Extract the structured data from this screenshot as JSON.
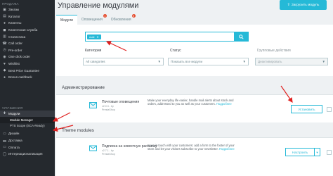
{
  "sidebar": {
    "section_sell": "ПРОДАЖА",
    "items": [
      {
        "label": "Заказы",
        "icon": "cart-icon"
      },
      {
        "label": "Каталог",
        "icon": "store-icon"
      },
      {
        "label": "Клиенты",
        "icon": "person-icon"
      },
      {
        "label": "Клиентская служба",
        "icon": "chat-icon"
      },
      {
        "label": "Статистика",
        "icon": "chart-icon"
      },
      {
        "label": "Call order",
        "icon": "phone-icon"
      },
      {
        "label": "Pre-order",
        "icon": "clock-icon"
      },
      {
        "label": "One click order",
        "icon": "click-icon"
      },
      {
        "label": "Wishlist",
        "icon": "heart-icon"
      },
      {
        "label": "Best Price Guarantee",
        "icon": "tag-icon"
      },
      {
        "label": "Bonus cashback",
        "icon": "coin-icon"
      }
    ],
    "section_improve": "УЛУЧШЕНИЯ",
    "modules": {
      "label": "Модули",
      "icon": "puzzle-icon"
    },
    "sub_items": [
      "Module Manager",
      "PTS Scope (SCA-Ready)"
    ],
    "bottom_items": [
      {
        "label": "Дизайн",
        "icon": "desktop-icon"
      },
      {
        "label": "Доставка",
        "icon": "truck-icon"
      },
      {
        "label": "Оплата",
        "icon": "card-icon"
      },
      {
        "label": "Интернационализация",
        "icon": "globe-icon"
      }
    ]
  },
  "header": {
    "title": "Управление модулями",
    "upload_button": "Загрузить модуль"
  },
  "tabs": [
    {
      "label": "Модули",
      "active": true,
      "badge": ""
    },
    {
      "label": "Оповещения",
      "active": false,
      "badge": "1"
    },
    {
      "label": "Обновления",
      "active": false,
      "badge": "5"
    }
  ],
  "search": {
    "tag": "mail"
  },
  "filters": {
    "category_label": "Категория",
    "category_value": "All categories",
    "status_label": "Статус",
    "status_value": "Показать все модули",
    "bulk_label": "Групповые действия",
    "bulk_value": "Деактивировать"
  },
  "sections": [
    {
      "title": "Администрирование",
      "module": {
        "name": "Почтовые оповещения",
        "version": "v2.0.3 - by",
        "author": "PrestaShop",
        "description": "Make your everyday life easier, handle mail alerts about stock and orders, addressed to you as well as your customers.",
        "more": "Подробнее",
        "button": "Установить"
      }
    },
    {
      "title": "Theme modules",
      "module": {
        "name": "Подписка на новостную рассылку",
        "version": "v2.7.1 - by",
        "author": "PrestaShop",
        "description": "Keep in touch with your customers: add a form to the footer of your store and let your visitors subscribe to your newsletter.",
        "more": "Подробнее",
        "button": "Настроить"
      }
    }
  ],
  "colors": {
    "accent": "#25b9d7",
    "arrow": "#e0201f",
    "sidebar_bg": "#25292e"
  }
}
